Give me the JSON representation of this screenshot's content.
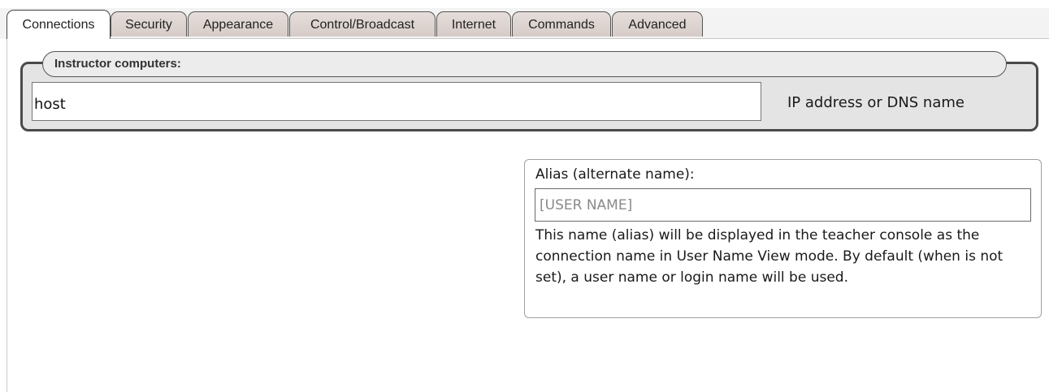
{
  "tabs": [
    {
      "label": "Connections",
      "active": true
    },
    {
      "label": "Security",
      "active": false
    },
    {
      "label": "Appearance",
      "active": false
    },
    {
      "label": "Control/Broadcast",
      "active": false
    },
    {
      "label": "Internet",
      "active": false
    },
    {
      "label": "Commands",
      "active": false
    },
    {
      "label": "Advanced",
      "active": false
    }
  ],
  "instructor": {
    "group_label": "Instructor computers:",
    "host_value": "host",
    "hint": "IP address or DNS name"
  },
  "alias": {
    "title": "Alias (alternate name):",
    "placeholder": "[USER NAME]",
    "value": "",
    "description": "This name (alias) will be displayed in the teacher console as the connection name in User Name View mode. By default (when is not set), a user name or login name will be used."
  }
}
